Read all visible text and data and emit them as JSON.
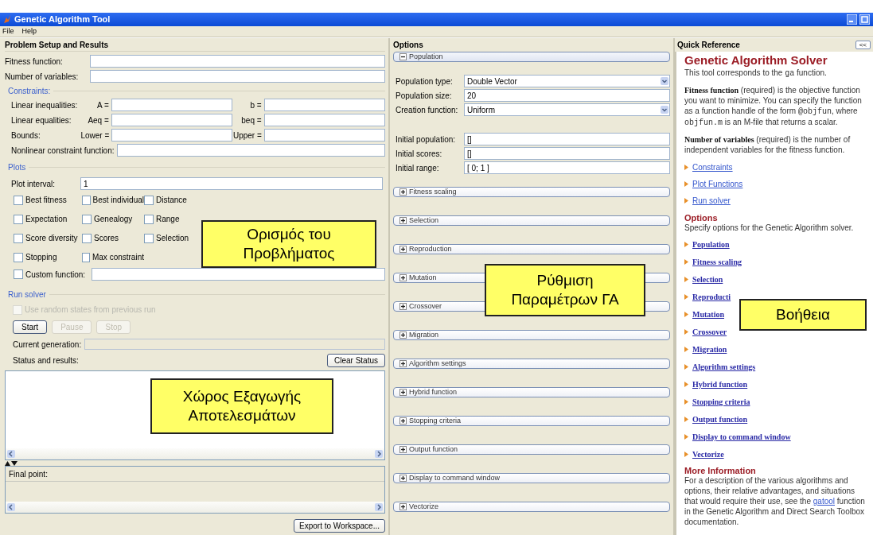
{
  "window": {
    "title": "Genetic Algorithm Tool"
  },
  "menu": [
    "File",
    "Help"
  ],
  "problem_setup": {
    "title": "Problem Setup and Results",
    "fields": [
      {
        "label": "Fitness function:"
      },
      {
        "label": "Number of variables:"
      }
    ],
    "constraints": {
      "title": "Constraints:",
      "rows": [
        {
          "label": "Linear inequalities:",
          "fields": [
            {
              "label": "A ="
            },
            {
              "label": "b ="
            }
          ]
        },
        {
          "label": "Linear equalities:",
          "fields": [
            {
              "label": "Aeq ="
            },
            {
              "label": "beq ="
            }
          ]
        },
        {
          "label": "Bounds:",
          "fields": [
            {
              "label": "Lower ="
            },
            {
              "label": "Upper ="
            }
          ]
        }
      ],
      "nonlinear": {
        "label": "Nonlinear constraint function:"
      }
    },
    "plots": {
      "title": "Plots",
      "plot_interval": {
        "label": "Plot interval:",
        "value": "1"
      },
      "checkboxes": [
        {
          "label": "Best fitness",
          "checked": false
        },
        {
          "label": "Best individual",
          "checked": false
        },
        {
          "label": "Distance",
          "checked": false
        },
        {
          "label": "Expectation",
          "checked": false
        },
        {
          "label": "Genealogy",
          "checked": false
        },
        {
          "label": "Range",
          "checked": false
        },
        {
          "label": "Score diversity",
          "checked": false
        },
        {
          "label": "Scores",
          "checked": false
        },
        {
          "label": "Selection",
          "checked": false
        },
        {
          "label": "Stopping",
          "checked": false
        },
        {
          "label": "Max constraint",
          "checked": false
        }
      ],
      "custom_function": {
        "label": "Custom function:",
        "checked": false
      }
    },
    "run_solver": {
      "title": "Run solver",
      "random_states": {
        "label": "Use random states from previous run",
        "checked": false,
        "disabled": true
      },
      "buttons": [
        {
          "label": "Start",
          "disabled": false
        },
        {
          "label": "Pause",
          "disabled": true
        },
        {
          "label": "Stop",
          "disabled": true
        }
      ],
      "current_generation": {
        "label": "Current generation:"
      },
      "status": {
        "label": "Status and results:",
        "button": "Clear Status"
      },
      "final_point": {
        "label": "Final point:"
      },
      "export_button": "Export to Workspace..."
    }
  },
  "options": {
    "title": "Options",
    "sections": [
      {
        "label": "Population",
        "expanded": true,
        "fields": [
          {
            "kind": "select",
            "label": "Population type:",
            "value": "Double Vector"
          },
          {
            "kind": "text",
            "label": "Population size:",
            "value": "20"
          },
          {
            "kind": "select",
            "label": "Creation function:",
            "value": "Uniform"
          },
          {
            "kind": "gap"
          },
          {
            "kind": "text",
            "label": "Initial population:",
            "value": "[]"
          },
          {
            "kind": "text",
            "label": "Initial scores:",
            "value": "[]"
          },
          {
            "kind": "text",
            "label": "Initial range:",
            "value": "[ 0; 1 ]"
          }
        ]
      },
      {
        "label": "Fitness scaling",
        "expanded": false
      },
      {
        "label": "Selection",
        "expanded": false
      },
      {
        "label": "Reproduction",
        "expanded": false
      },
      {
        "label": "Mutation",
        "expanded": false
      },
      {
        "label": "Crossover",
        "expanded": false
      },
      {
        "label": "Migration",
        "expanded": false
      },
      {
        "label": "Algorithm settings",
        "expanded": false
      },
      {
        "label": "Hybrid function",
        "expanded": false
      },
      {
        "label": "Stopping criteria",
        "expanded": false
      },
      {
        "label": "Output function",
        "expanded": false
      },
      {
        "label": "Display to command window",
        "expanded": false
      },
      {
        "label": "Vectorize",
        "expanded": false
      }
    ]
  },
  "quick_reference": {
    "title": "Quick Reference",
    "collapse_button": "<<",
    "heading": "Genetic Algorithm Solver",
    "paragraphs": [
      [
        {
          "text": "This tool corresponds to the "
        },
        {
          "kind": "code",
          "text": "ga"
        },
        {
          "text": " function."
        }
      ],
      [
        {
          "kind": "bold",
          "text": "Fitness function"
        },
        {
          "text": " (required) is the objective function you want to minimize. You can specify the function as a function handle of the form "
        },
        {
          "kind": "code",
          "text": "@objfun"
        },
        {
          "text": ", where "
        },
        {
          "kind": "code",
          "text": "objfun.m"
        },
        {
          "text": " is an M-file that returns a scalar."
        }
      ],
      [
        {
          "kind": "bold",
          "text": "Number of variables"
        },
        {
          "text": " (required) is the number of independent variables for the fitness function."
        }
      ]
    ],
    "links": [
      "Constraints",
      "Plot Functions",
      "Run solver"
    ],
    "options_heading": "Options",
    "options_text": "Specify options for the Genetic Algorithm solver.",
    "option_links": [
      "Population",
      "Fitness scaling",
      "Selection",
      "Reproducti",
      "Mutation",
      "Crossover",
      "Migration",
      "Algorithm settings",
      "Hybrid function",
      "Stopping criteria",
      "Output function",
      "Display to command window",
      "Vectorize"
    ],
    "more_heading": "More Information",
    "more_text": [
      {
        "text": "For a description of the various algorithms and options, their relative advantages, and situations that would require their use, see the "
      },
      {
        "kind": "link",
        "text": "gatool"
      },
      {
        "text": " function in the Genetic Algorithm and Direct Search Toolbox documentation."
      }
    ]
  },
  "callouts": [
    "Ορισμός του\nΠροβλήματος",
    "Χώρος Εξαγωγής\nΑποτελεσμάτων",
    "Ρύθμιση\nΠαραμέτρων ΓΑ",
    "Βοήθεια"
  ]
}
